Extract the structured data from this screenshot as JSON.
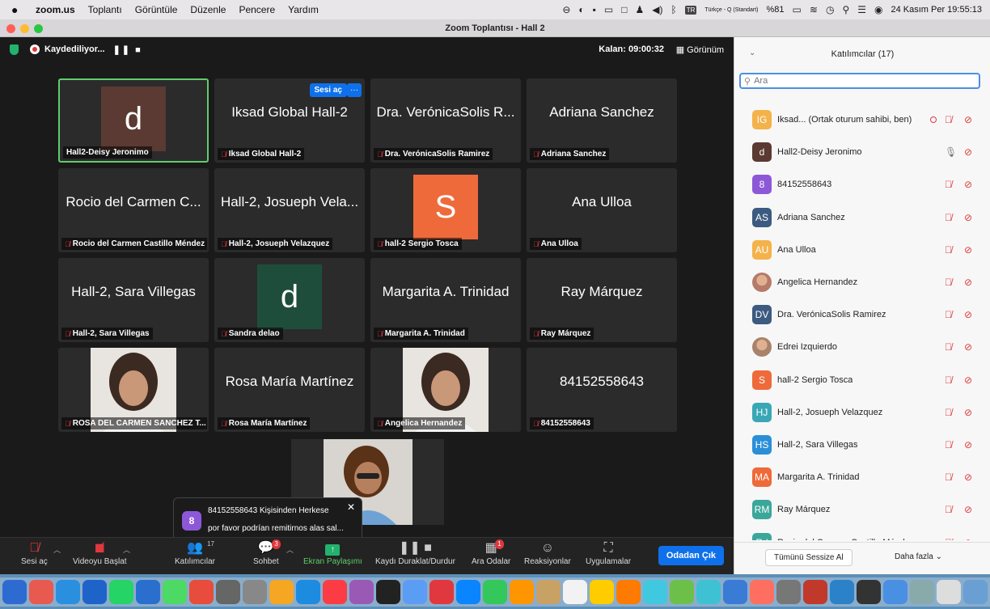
{
  "menubar": {
    "apple": "",
    "items": [
      "zoom.us",
      "Toplantı",
      "Görüntüle",
      "Düzenle",
      "Pencere",
      "Yardım"
    ],
    "input_source": "Türkçe - Q (Standart)",
    "battery": "%81",
    "datetime": "24 Kasım Per  19:55:13"
  },
  "window": {
    "title": "Zoom Toplantısı - Hall 2"
  },
  "meeting": {
    "recording_label": "Kaydediliyor...",
    "rec_controls": "❚❚ ■",
    "time_left": "Kalan: 09:00:32",
    "view_label": "Görünüm",
    "unmute_button": "Sesi aç",
    "more_button": "···"
  },
  "tiles": [
    {
      "big": "",
      "avatar_letter": "d",
      "avatar_color": "#5a3a32",
      "label": "Hall2-Deisy Jeronimo",
      "muted": false,
      "active": true
    },
    {
      "big": "Iksad Global Hall-2",
      "label": "Iksad Global Hall-2",
      "muted": true
    },
    {
      "big": "Dra. VerónicaSolis R...",
      "label": "Dra. VerónicaSolis Ramirez",
      "muted": true
    },
    {
      "big": "Adriana Sanchez",
      "label": "Adriana Sanchez",
      "muted": true
    },
    {
      "big": "Rocio del Carmen C...",
      "label": "Rocio del Carmen Castillo Méndez",
      "muted": true
    },
    {
      "big": "Hall-2, Josueph Vela...",
      "label": "Hall-2, Josueph Velazquez",
      "muted": true
    },
    {
      "big": "",
      "avatar_letter": "S",
      "avatar_color": "#ee6a3a",
      "label": "hall-2 Sergio Tosca",
      "muted": true
    },
    {
      "big": "Ana Ulloa",
      "label": "Ana Ulloa",
      "muted": true
    },
    {
      "big": "Hall-2, Sara Villegas",
      "label": "Hall-2, Sara Villegas",
      "muted": true
    },
    {
      "big": "",
      "avatar_letter": "d",
      "avatar_color": "#1f4d3c",
      "label": "Sandra delao",
      "muted": true
    },
    {
      "big": "Margarita A. Trinidad",
      "label": "Margarita A. Trinidad",
      "muted": true
    },
    {
      "big": "Ray Márquez",
      "label": "Ray Márquez",
      "muted": true
    },
    {
      "big": "",
      "photo": true,
      "label": "ROSA DEL CARMEN SANCHEZ T...",
      "muted": true
    },
    {
      "big": "Rosa María Martínez",
      "label": "Rosa María Martínez",
      "muted": true
    },
    {
      "big": "",
      "photo": true,
      "label": "Angelica Hernandez",
      "muted": true
    },
    {
      "big": "84152558643",
      "label": "84152558643",
      "muted": true
    }
  ],
  "toast": {
    "avatar": "8",
    "line1": "84152558643 Kişisinden Herkese",
    "line2": "por favor podrían remitirnos alas sal...",
    "close": "✕"
  },
  "toolbar": {
    "unmute": "Sesi aç",
    "start_video": "Videoyu Başlat",
    "participants": "Katılımcılar",
    "participants_count": "17",
    "chat": "Sohbet",
    "chat_badge": "3",
    "share": "Ekran Paylaşımı",
    "record": "Kaydı Duraklat/Durdur",
    "breakout": "Ara Odalar",
    "breakout_badge": "1",
    "reactions": "Reaksiyonlar",
    "apps": "Uygulamalar",
    "leave": "Odadan Çık"
  },
  "panel": {
    "title": "Katılımcılar (17)",
    "search_placeholder": "Ara",
    "mute_all": "Tümünü Sessize Al",
    "more": "Daha fazla ⌄",
    "participants": [
      {
        "initials": "IG",
        "color": "#f4b24a",
        "name": "Iksad...  (Ortak oturum sahibi, ben)",
        "mic": "muted",
        "rec": true
      },
      {
        "initials": "d",
        "color": "#5a3a32",
        "name": "Hall2-Deisy Jeronimo",
        "mic": "on"
      },
      {
        "initials": "8",
        "color": "#8d58d8",
        "name": "84152558643",
        "mic": "muted"
      },
      {
        "initials": "AS",
        "color": "#3d5a80",
        "name": "Adriana Sanchez",
        "mic": "muted"
      },
      {
        "initials": "AU",
        "color": "#f4b24a",
        "name": "Ana Ulloa",
        "mic": "muted"
      },
      {
        "initials": "",
        "color": "#b57a6a",
        "name": "Angelica Hernandez",
        "mic": "muted",
        "photo": true
      },
      {
        "initials": "DV",
        "color": "#3d5a80",
        "name": "Dra. VerónicaSolis Ramirez",
        "mic": "muted"
      },
      {
        "initials": "",
        "color": "#a8826a",
        "name": "Edrei Izquierdo",
        "mic": "muted",
        "photo": true
      },
      {
        "initials": "S",
        "color": "#ee6a3a",
        "name": "hall-2 Sergio Tosca",
        "mic": "muted"
      },
      {
        "initials": "HJ",
        "color": "#3aa7b5",
        "name": "Hall-2, Josueph Velazquez",
        "mic": "muted"
      },
      {
        "initials": "HS",
        "color": "#2b8fd8",
        "name": "Hall-2, Sara Villegas",
        "mic": "muted"
      },
      {
        "initials": "MA",
        "color": "#ee6a3a",
        "name": "Margarita A. Trinidad",
        "mic": "muted"
      },
      {
        "initials": "RM",
        "color": "#3aa79a",
        "name": "Ray Márquez",
        "mic": "muted"
      },
      {
        "initials": "Rd",
        "color": "#3aa79a",
        "name": "Rocio del Carmen Castillo Méndez",
        "mic": "muted"
      }
    ]
  },
  "dock": {
    "colors": [
      "#3b7ad8",
      "#2e6bd1",
      "#e85a4f",
      "#2b8fe0",
      "#1e63c9",
      "#25d366",
      "#2a6fcd",
      "#4cd964",
      "#e74c3c",
      "#666",
      "#888",
      "#f5a623",
      "#1d8be0",
      "#fc3c44",
      "#9b59b6",
      "#222",
      "#5b9cf5",
      "#e0383e",
      "#0a84ff",
      "#34c759",
      "#ff9500",
      "#c8a165",
      "#f2f2f2",
      "#ffcc00",
      "#ff7a00",
      "#40c8e0",
      "#6cc04a",
      "#3ec1d3",
      "#3a7bd5",
      "#ff6f61",
      "#777",
      "#c0392b",
      "#2c82c9",
      "#333",
      "#4a90e2",
      "#8aa",
      "#ddd",
      "#6a9fd4",
      "#f0f0f0"
    ]
  }
}
